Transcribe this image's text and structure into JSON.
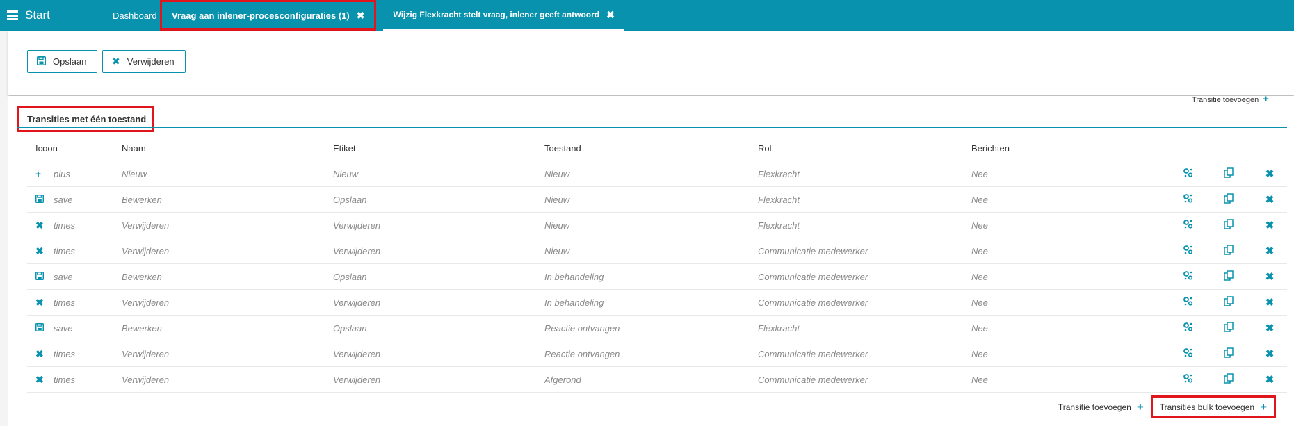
{
  "topbar": {
    "start_label": "Start",
    "tabs": [
      {
        "label": "Dashboard"
      },
      {
        "label": "Vraag aan inlener-procesconfiguraties (1)",
        "close": "✖"
      },
      {
        "label": "Wijzig Flexkracht stelt vraag, inlener geeft antwoord",
        "close": "✖"
      }
    ]
  },
  "toolbar": {
    "save_label": "Opslaan",
    "delete_label": "Verwijderen"
  },
  "section": {
    "title": "Transities met één toestand",
    "add_top_label": "Transitie toevoegen"
  },
  "table": {
    "headers": [
      "Icoon",
      "Naam",
      "Etiket",
      "Toestand",
      "Rol",
      "Berichten"
    ],
    "rows": [
      {
        "icon": "plus",
        "naam": "Nieuw",
        "etiket": "Nieuw",
        "toestand": "Nieuw",
        "rol": "Flexkracht",
        "berichten": "Nee"
      },
      {
        "icon": "save",
        "naam": "Bewerken",
        "etiket": "Opslaan",
        "toestand": "Nieuw",
        "rol": "Flexkracht",
        "berichten": "Nee"
      },
      {
        "icon": "times",
        "naam": "Verwijderen",
        "etiket": "Verwijderen",
        "toestand": "Nieuw",
        "rol": "Flexkracht",
        "berichten": "Nee"
      },
      {
        "icon": "times",
        "naam": "Verwijderen",
        "etiket": "Verwijderen",
        "toestand": "Nieuw",
        "rol": "Communicatie medewerker",
        "berichten": "Nee"
      },
      {
        "icon": "save",
        "naam": "Bewerken",
        "etiket": "Opslaan",
        "toestand": "In behandeling",
        "rol": "Communicatie medewerker",
        "berichten": "Nee"
      },
      {
        "icon": "times",
        "naam": "Verwijderen",
        "etiket": "Verwijderen",
        "toestand": "In behandeling",
        "rol": "Communicatie medewerker",
        "berichten": "Nee"
      },
      {
        "icon": "save",
        "naam": "Bewerken",
        "etiket": "Opslaan",
        "toestand": "Reactie ontvangen",
        "rol": "Flexkracht",
        "berichten": "Nee"
      },
      {
        "icon": "times",
        "naam": "Verwijderen",
        "etiket": "Verwijderen",
        "toestand": "Reactie ontvangen",
        "rol": "Communicatie medewerker",
        "berichten": "Nee"
      },
      {
        "icon": "times",
        "naam": "Verwijderen",
        "etiket": "Verwijderen",
        "toestand": "Afgerond",
        "rol": "Communicatie medewerker",
        "berichten": "Nee"
      }
    ]
  },
  "footer": {
    "add_label": "Transitie toevoegen",
    "bulk_add_label": "Transities bulk toevoegen"
  },
  "colors": {
    "accent": "#0892ad",
    "highlight": "#e0161c"
  }
}
